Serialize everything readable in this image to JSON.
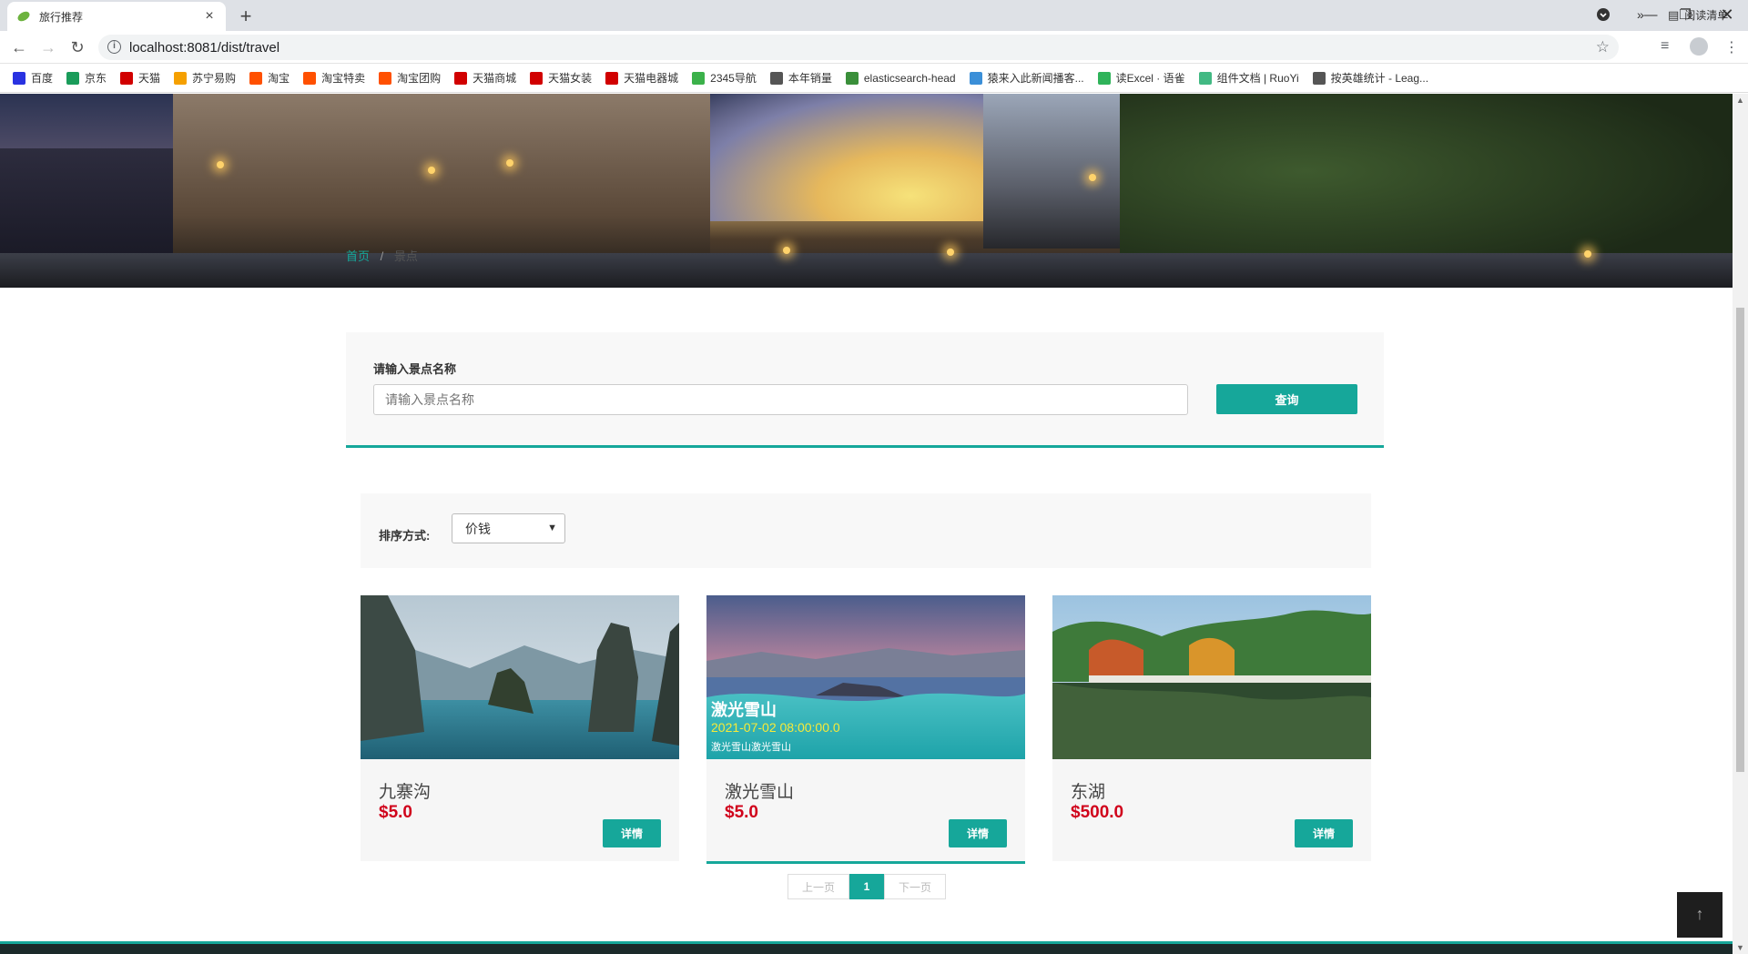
{
  "browser": {
    "tab_title": "旅行推荐",
    "url": "localhost:8081/dist/travel",
    "bookmarks": [
      {
        "label": "百度",
        "icon": "baidu-icon",
        "color": "#2932e1"
      },
      {
        "label": "京东",
        "icon": "jd-icon",
        "color": "#1a9c5a"
      },
      {
        "label": "天猫",
        "icon": "tmall-icon",
        "color": "#d10000"
      },
      {
        "label": "苏宁易购",
        "icon": "suning-icon",
        "color": "#f5a000"
      },
      {
        "label": "淘宝",
        "icon": "taobao-icon",
        "color": "#ff5000"
      },
      {
        "label": "淘宝特卖",
        "icon": "taobao-icon",
        "color": "#ff5000"
      },
      {
        "label": "淘宝团购",
        "icon": "taobao-icon",
        "color": "#ff5000"
      },
      {
        "label": "天猫商城",
        "icon": "tmall-icon",
        "color": "#d10000"
      },
      {
        "label": "天猫女装",
        "icon": "tmall-icon",
        "color": "#d10000"
      },
      {
        "label": "天猫电器城",
        "icon": "tmall-icon",
        "color": "#d10000"
      },
      {
        "label": "2345导航",
        "icon": "nav2345-icon",
        "color": "#3bb14a"
      },
      {
        "label": "本年销量",
        "icon": "globe-icon",
        "color": "#555555"
      },
      {
        "label": "elasticsearch-head",
        "icon": "es-icon",
        "color": "#3a8f3a"
      },
      {
        "label": "猿来入此新闻播客...",
        "icon": "yuan-icon",
        "color": "#3b8fd8"
      },
      {
        "label": "读Excel · 语雀",
        "icon": "yuque-icon",
        "color": "#2fb35a"
      },
      {
        "label": "组件文档 | RuoYi",
        "icon": "ruoyi-icon",
        "color": "#42b983"
      },
      {
        "label": "按英雄统计 - Leag...",
        "icon": "globe-icon",
        "color": "#555555"
      }
    ],
    "more_label": "»",
    "reading_list": "阅读清单"
  },
  "breadcrumb": {
    "home": "首页",
    "sep": "/",
    "current": "景点"
  },
  "search": {
    "label": "请输入景点名称",
    "placeholder": "请输入景点名称",
    "button": "查询"
  },
  "sort": {
    "label": "排序方式:",
    "selected": "价钱"
  },
  "cards": [
    {
      "name": "九寨沟",
      "price": "$5.0",
      "detail": "详情"
    },
    {
      "name": "激光雪山",
      "price": "$5.0",
      "detail": "详情",
      "overlay_title": "激光雪山",
      "overlay_date": "2021-07-02 08:00:00.0",
      "overlay_desc": "激光雪山激光雪山"
    },
    {
      "name": "东湖",
      "price": "$500.0",
      "detail": "详情"
    }
  ],
  "pager": {
    "prev": "上一页",
    "current": "1",
    "next": "下一页"
  },
  "colors": {
    "accent": "#16a79a",
    "price": "#d0021b"
  }
}
